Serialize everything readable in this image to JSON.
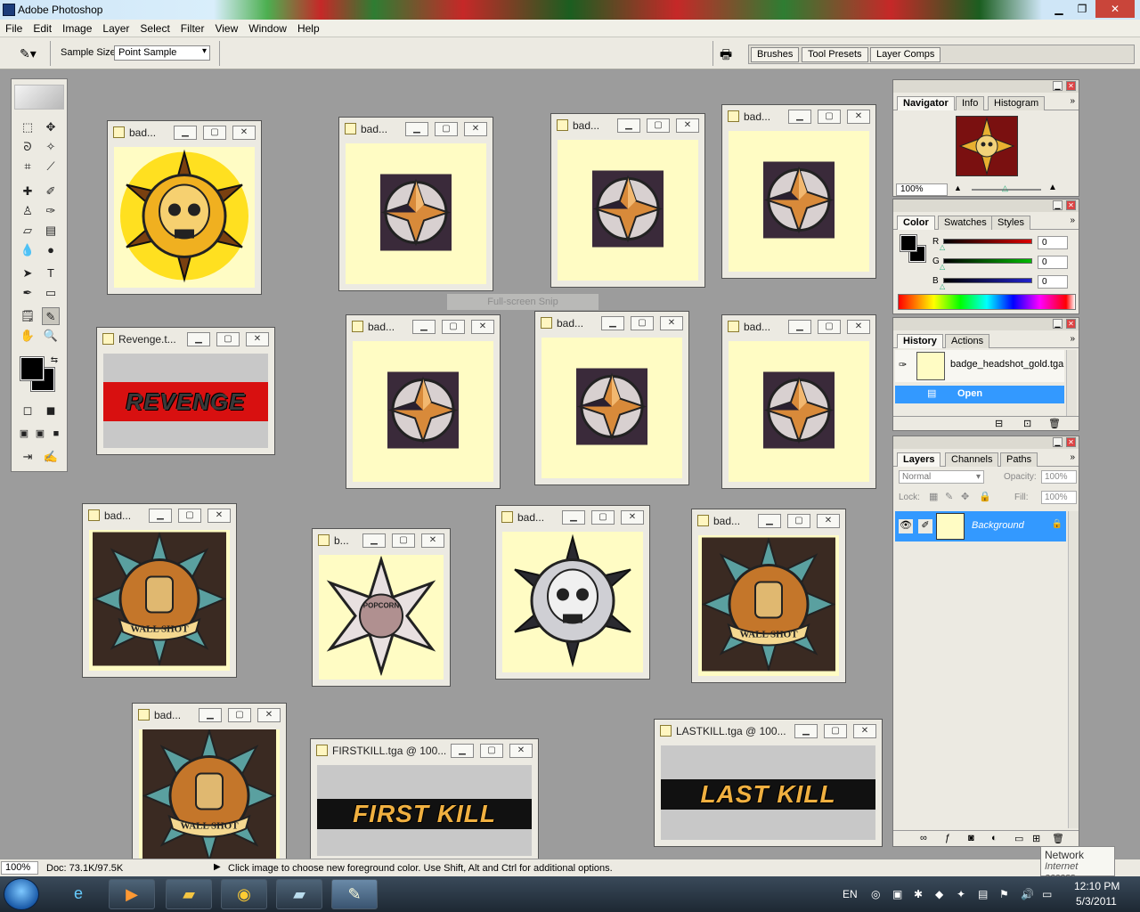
{
  "app": {
    "title": "Adobe Photoshop"
  },
  "menu": [
    "File",
    "Edit",
    "Image",
    "Layer",
    "Select",
    "Filter",
    "View",
    "Window",
    "Help"
  ],
  "options": {
    "sample_size_label": "Sample Size:",
    "sample_size_value": "Point Sample"
  },
  "well_tabs": [
    "Brushes",
    "Tool Presets",
    "Layer Comps"
  ],
  "documents": [
    {
      "title": "bad..."
    },
    {
      "title": "bad..."
    },
    {
      "title": "bad..."
    },
    {
      "title": "bad..."
    },
    {
      "title": "Revenge.t..."
    },
    {
      "title": "bad..."
    },
    {
      "title": "bad..."
    },
    {
      "title": "bad..."
    },
    {
      "title": "bad..."
    },
    {
      "title": "b..."
    },
    {
      "title": "bad..."
    },
    {
      "title": "bad..."
    },
    {
      "title": "bad..."
    },
    {
      "title": "FIRSTKILL.tga @ 100..."
    },
    {
      "title": "LASTKILL.tga @ 100..."
    }
  ],
  "banners": {
    "revenge": "REVENGE",
    "firstkill": "FIRST KILL",
    "lastkill": "LAST KILL"
  },
  "badge_labels": {
    "wallshot": "WALL SHOT",
    "popcorn": "POPCORN"
  },
  "snip_watermark": "Full-screen Snip",
  "navigator": {
    "tabs": [
      "Navigator",
      "Info",
      "Histogram"
    ],
    "zoom": "100%"
  },
  "color": {
    "tabs": [
      "Color",
      "Swatches",
      "Styles"
    ],
    "channels": [
      {
        "name": "R",
        "value": "0"
      },
      {
        "name": "G",
        "value": "0"
      },
      {
        "name": "B",
        "value": "0"
      }
    ]
  },
  "history": {
    "tabs": [
      "History",
      "Actions"
    ],
    "snapshot": "badge_headshot_gold.tga",
    "state": "Open"
  },
  "layers": {
    "tabs": [
      "Layers",
      "Channels",
      "Paths"
    ],
    "blend_mode": "Normal",
    "opacity_label": "Opacity:",
    "opacity": "100%",
    "lock_label": "Lock:",
    "fill_label": "Fill:",
    "fill": "100%",
    "layer_name": "Background"
  },
  "status": {
    "zoom": "100%",
    "doc": "Doc: 73.1K/97.5K",
    "hint": "Click image to choose new foreground color.  Use Shift, Alt and Ctrl for additional options."
  },
  "tray": {
    "lang": "EN",
    "time": "12:10 PM",
    "date": "5/3/2011"
  },
  "tooltip": {
    "title": "Network",
    "subtitle": "Internet access"
  },
  "colors": {
    "accent": "#3399ff",
    "canvas_bg": "#fffcc4",
    "workspace": "#9c9c9c"
  }
}
